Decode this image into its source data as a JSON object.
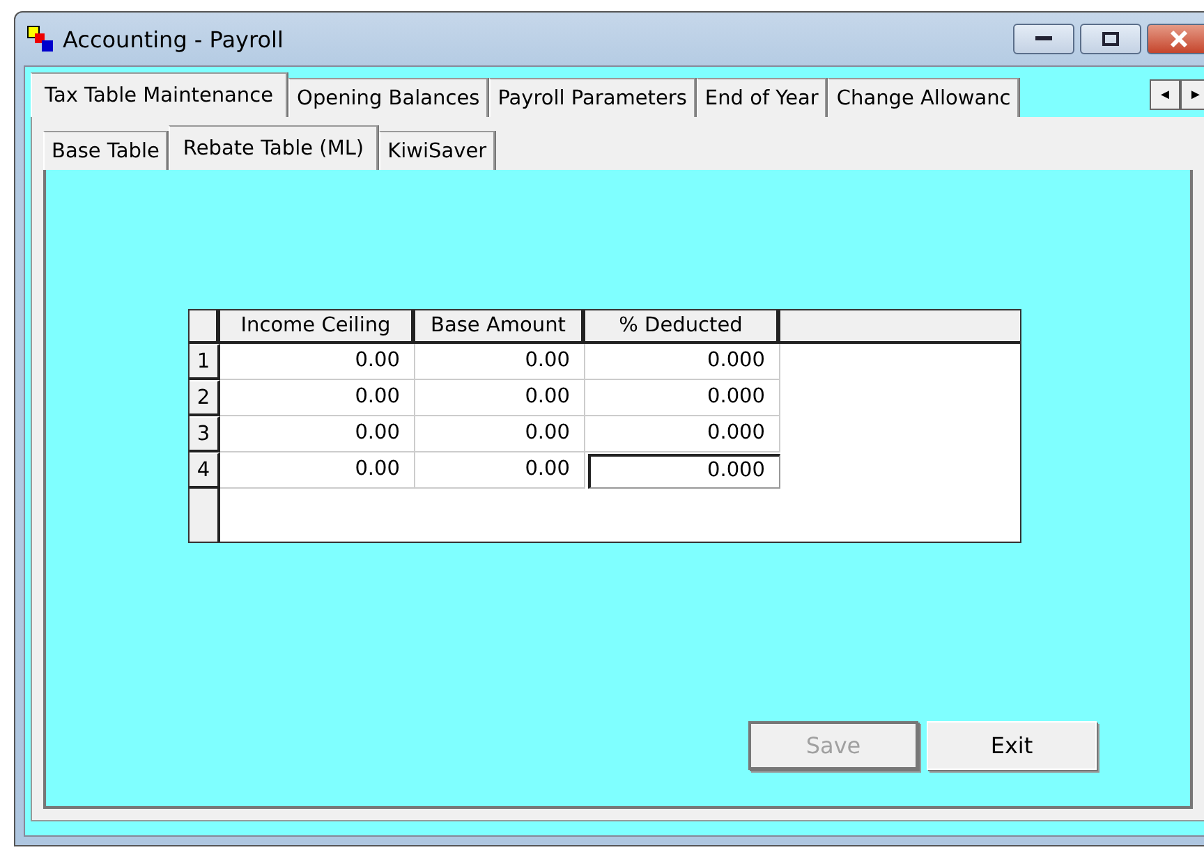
{
  "window": {
    "title": "Accounting - Payroll"
  },
  "tabs": [
    {
      "label": "Tax Table Maintenance",
      "selected": true
    },
    {
      "label": "Opening Balances",
      "selected": false
    },
    {
      "label": "Payroll Parameters",
      "selected": false
    },
    {
      "label": "End of Year",
      "selected": false
    },
    {
      "label": "Change Allowanc",
      "selected": false
    }
  ],
  "tab_scroll": [
    "◄",
    "►"
  ],
  "subtabs": [
    {
      "label": "Base Table",
      "selected": false
    },
    {
      "label": "Rebate Table (ML)",
      "selected": true
    },
    {
      "label": "KiwiSaver",
      "selected": false
    }
  ],
  "table": {
    "columns": [
      "Income Ceiling",
      "Base Amount",
      "% Deducted"
    ],
    "rows": [
      {
        "number": "1",
        "cells": [
          "0.00",
          "0.00",
          "0.000"
        ],
        "focused_cell": false
      },
      {
        "number": "2",
        "cells": [
          "0.00",
          "0.00",
          "0.000"
        ],
        "focused_cell": false
      },
      {
        "number": "3",
        "cells": [
          "0.00",
          "0.00",
          "0.000"
        ],
        "focused_cell": false
      },
      {
        "number": "4",
        "cells": [
          "0.00",
          "0.00",
          "0.000"
        ],
        "focused_cell": true
      }
    ]
  },
  "buttons": [
    {
      "label": "Save",
      "disabled": true
    },
    {
      "label": "Exit",
      "disabled": false
    }
  ]
}
